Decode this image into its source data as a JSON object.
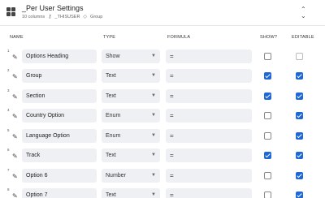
{
  "header": {
    "title": "_Per User Settings",
    "columns_text": "10 columns",
    "key_label": "_THISUSER",
    "tag_label": "Group"
  },
  "columns": {
    "name": "NAME",
    "type": "TYPE",
    "formula": "FORMULA",
    "show": "SHOW?",
    "editable": "EDITABLE"
  },
  "rows": [
    {
      "num": "1",
      "name": "Options Heading",
      "type": "Show",
      "formula": "=",
      "show": false,
      "editable": false
    },
    {
      "num": "2",
      "name": "Group",
      "type": "Text",
      "formula": "=",
      "show": true,
      "editable": true
    },
    {
      "num": "3",
      "name": "Section",
      "type": "Text",
      "formula": "=",
      "show": true,
      "editable": true
    },
    {
      "num": "4",
      "name": "Country Option",
      "type": "Enum",
      "formula": "=",
      "show": false,
      "editable": true
    },
    {
      "num": "5",
      "name": "Language Option",
      "type": "Enum",
      "formula": "=",
      "show": false,
      "editable": true
    },
    {
      "num": "6",
      "name": "Track",
      "type": "Text",
      "formula": "=",
      "show": true,
      "editable": true
    },
    {
      "num": "7",
      "name": "Option 6",
      "type": "Number",
      "formula": "=",
      "show": false,
      "editable": true
    },
    {
      "num": "8",
      "name": "Option 7",
      "type": "Text",
      "formula": "=",
      "show": false,
      "editable": true
    }
  ],
  "colors": {
    "accent": "#1d68d6",
    "field_bg": "#eef0f3"
  },
  "icons": {
    "table": "grid-icon",
    "key": "key-icon",
    "tag": "tag-icon",
    "edit": "pencil-icon",
    "collapse": "chevron-updown-icon",
    "dropdown": "caret-down-icon"
  }
}
